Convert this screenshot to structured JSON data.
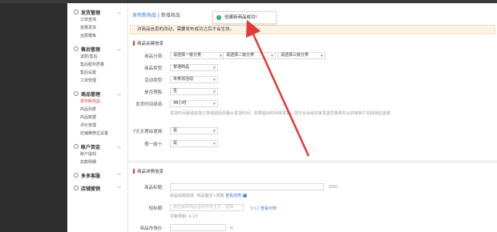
{
  "sidebar": {
    "groups": [
      {
        "title": "发货管理",
        "items": [
          "订单查询",
          "批量发货",
          "运费模板"
        ]
      },
      {
        "title": "售后管理",
        "items": [
          "退款/售后",
          "售后服务质量",
          "售后设置",
          "工单管理"
        ]
      },
      {
        "title": "商品管理",
        "items": [
          "发布新商品",
          "商品列表",
          "商品数据",
          "评价管理",
          "店铺推荐位设置"
        ]
      },
      {
        "title": "账户资金",
        "items": [
          "账户提现",
          "扣款明细"
        ]
      },
      {
        "title": "多多客服",
        "items": []
      },
      {
        "title": "店铺营销",
        "items": []
      }
    ],
    "active_item": "发布新商品"
  },
  "breadcrumb": {
    "link": "发布新商品",
    "sep": " | ",
    "current": "新增商品"
  },
  "notice": "对商品信息的改动，需要发布成功之后才会生效。",
  "toast": {
    "text": "创建新商品成功!"
  },
  "section1": {
    "title": "商品关键信息",
    "category_label": "商品分类:",
    "cat1": "请选择一级分类",
    "cat2": "请选择二级分类",
    "cat3": "请选择三级分类",
    "type_label": "商品类型:",
    "type_value": "普通商品",
    "activity_label": "活动类型:",
    "activity_value": "未参加活动",
    "presale_label": "是否预售:",
    "presale_value": "否",
    "ship_label": "发货时间承诺:",
    "ship_value": "48小时",
    "ship_help": "发货时间承诺是指订单成团后的最大发货时间，如果超出时间未发货，则平台会给买家发送优惠券并从商家账户扣除相应金额",
    "seven_days_label": "7天无理由退换:",
    "seven_days_value": "是",
    "fake_label": "假一赔十:",
    "fake_value": "是"
  },
  "section2": {
    "title": "商品详情信息",
    "name_label": "商品标题:",
    "name_count": "0/60",
    "name_help": "商品标题组成: 商品描述+规格",
    "name_help_link": "查看范例",
    "subtitle_label": "短标题:",
    "subtitle_placeholder": "用在最终商品活动中去主打，选填",
    "subtitle_count": "0/12",
    "subtitle_link": "查看示例",
    "subtitle_help": "字数限制: 9-13",
    "price_label": "商品市场价:",
    "price_unit": "元"
  }
}
